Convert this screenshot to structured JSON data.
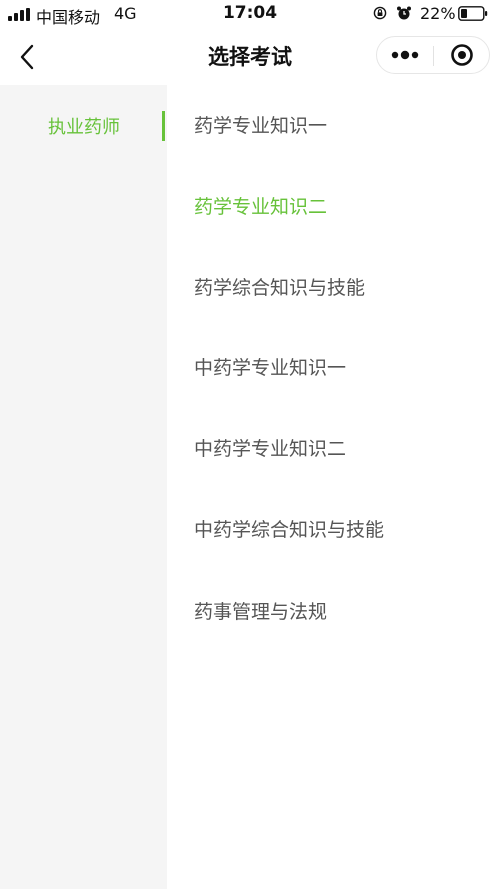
{
  "status_bar": {
    "carrier": "中国移动",
    "network": "4G",
    "time": "17:04",
    "battery_percent": "22%",
    "icons": [
      "signal-icon",
      "lock-rotation-icon",
      "alarm-icon",
      "battery-icon"
    ]
  },
  "nav": {
    "title": "选择考试",
    "back_icon": "chevron-left-icon",
    "more_icon": "more-dots-icon",
    "close_icon": "target-close-icon"
  },
  "sidebar": {
    "items": [
      {
        "label": "执业药师",
        "active": true
      }
    ]
  },
  "exams": {
    "items": [
      {
        "label": "药学专业知识一",
        "active": false
      },
      {
        "label": "药学专业知识二",
        "active": true
      },
      {
        "label": "药学综合知识与技能",
        "active": false
      },
      {
        "label": "中药学专业知识一",
        "active": false
      },
      {
        "label": "中药学专业知识二",
        "active": false
      },
      {
        "label": "中药学综合知识与技能",
        "active": false
      },
      {
        "label": "药事管理与法规",
        "active": false
      }
    ]
  },
  "colors": {
    "accent": "#67c23a",
    "text": "#555555",
    "sidebar_bg": "#f5f5f5"
  }
}
